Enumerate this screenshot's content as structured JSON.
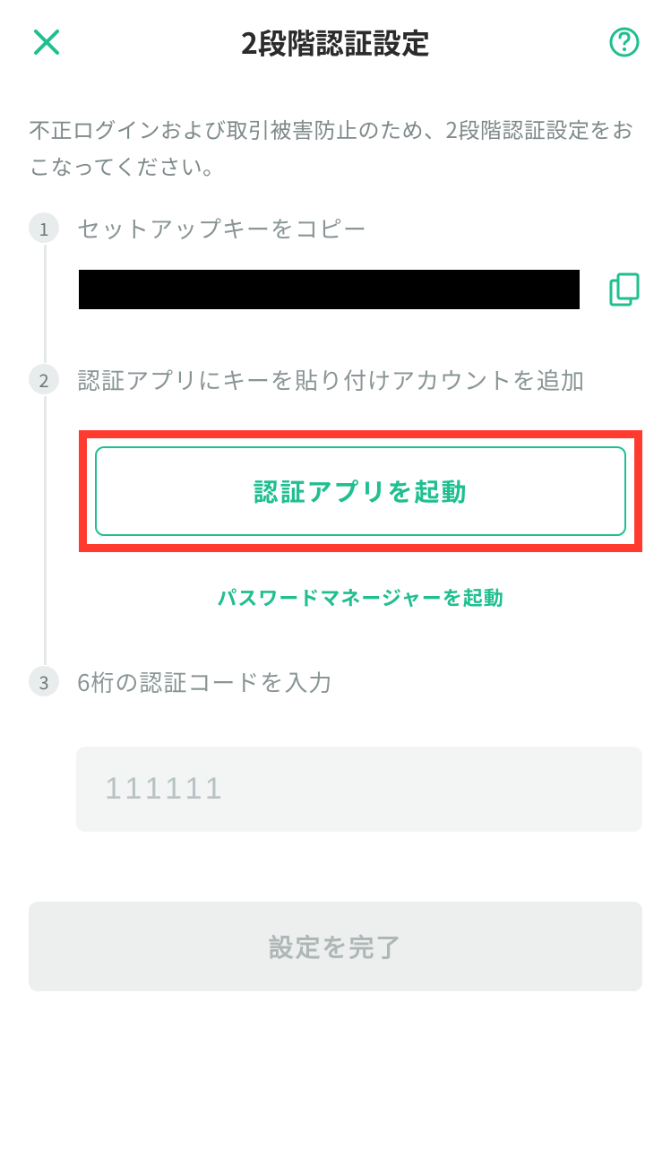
{
  "header": {
    "title": "2段階認証設定"
  },
  "description": "不正ログインおよび取引被害防止のため、2段階認証設定をおこなってください。",
  "steps": {
    "s1": {
      "num": "1",
      "label": "セットアップキーをコピー"
    },
    "s2": {
      "num": "2",
      "label": "認証アプリにキーを貼り付けアカウントを追加"
    },
    "s3": {
      "num": "3",
      "label": "6桁の認証コードを入力"
    }
  },
  "buttons": {
    "launch_auth_app": "認証アプリを起動",
    "launch_password_manager": "パスワードマネージャーを起動",
    "submit": "設定を完了"
  },
  "code_input": {
    "placeholder": "111111",
    "value": ""
  },
  "colors": {
    "accent": "#1fbf8f",
    "highlight_frame": "#ff3b30"
  }
}
